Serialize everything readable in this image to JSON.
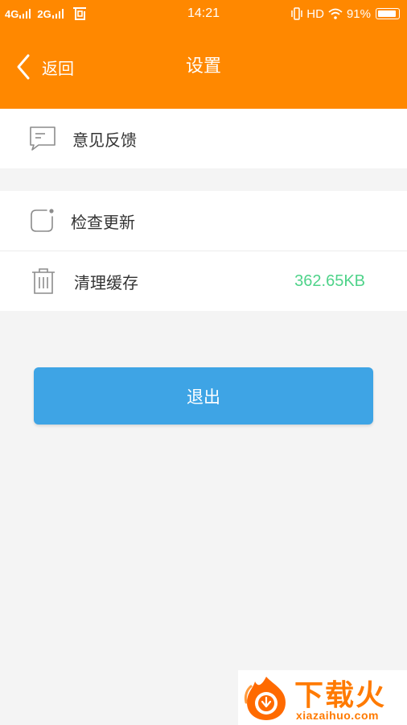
{
  "status_bar": {
    "sim1": "4G",
    "sim2": "2G",
    "time": "14:21",
    "hd": "HD",
    "battery_text": "91%",
    "battery_level": 0.91,
    "icons": [
      "signal-icon",
      "signal-icon",
      "sim-icon",
      "vibrate-icon",
      "wifi-icon",
      "battery-icon"
    ]
  },
  "navbar": {
    "back_label": "返回",
    "title": "设置",
    "back_icon": "chevron-left-icon"
  },
  "settings": {
    "group1": [
      {
        "label": "意见反馈",
        "icon": "feedback-icon"
      }
    ],
    "group2": [
      {
        "label": "检查更新",
        "icon": "update-icon"
      },
      {
        "label": "清理缓存",
        "icon": "trash-icon",
        "value": "362.65KB"
      }
    ]
  },
  "logout": {
    "label": "退出"
  },
  "watermark": {
    "brand": "下载火",
    "domain": "xiazaihuo.com"
  },
  "colors": {
    "header": "#ff8800",
    "background": "#f4f4f4",
    "logout_button": "#3ea4e5",
    "cache_value": "#4fd38a",
    "watermark": "#ff7a00"
  }
}
